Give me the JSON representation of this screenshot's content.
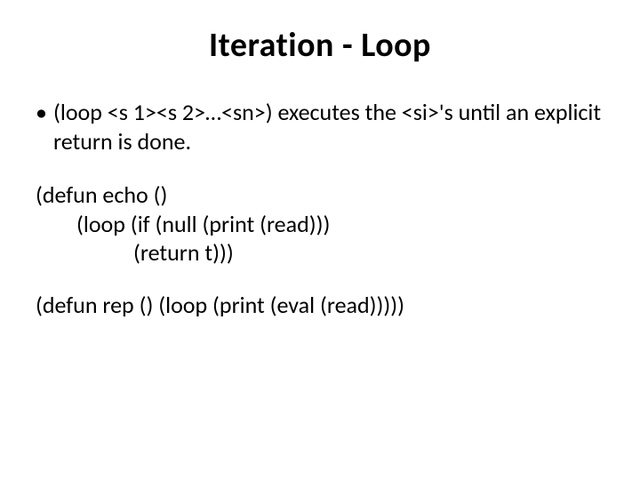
{
  "title": "Iteration - Loop",
  "bullet_text": "(loop <s 1><s 2>…<sn>) executes the <si>'s until an explicit return is done.",
  "code1": {
    "l1": "(defun echo ()",
    "l2": "(loop (if (null (print (read)))",
    "l3": "(return t)))"
  },
  "code2": {
    "l1": "(defun rep () (loop (print (eval (read)))))"
  }
}
